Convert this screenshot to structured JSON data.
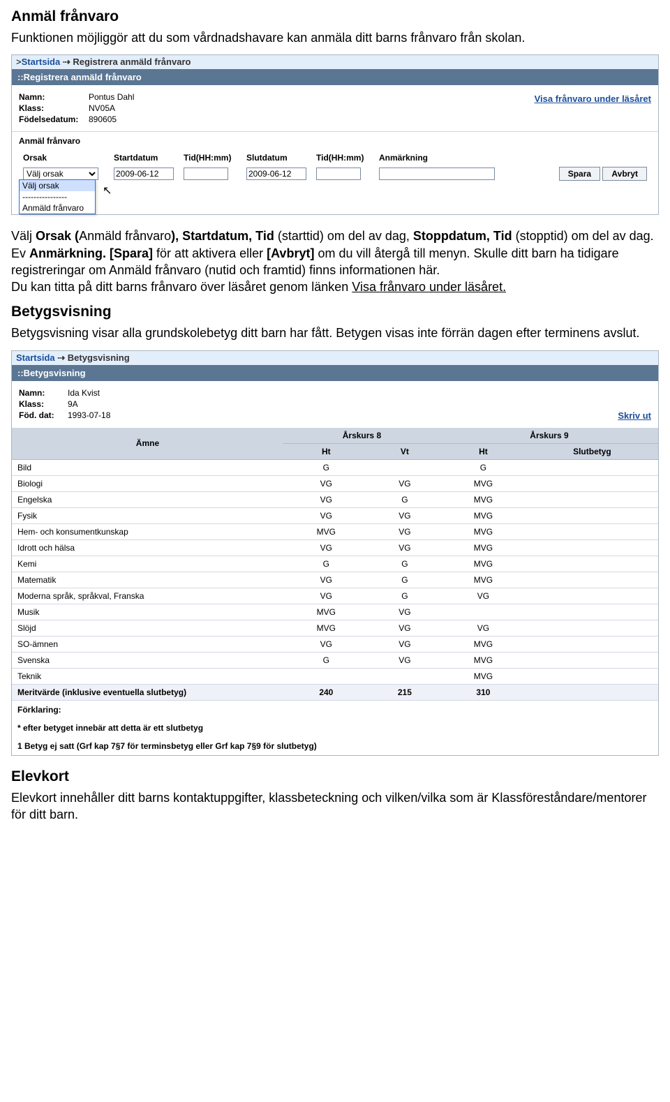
{
  "s1": {
    "title": "Anmäl frånvaro",
    "intro": "Funktionen möjliggör att du som vårdnadshavare kan anmäla ditt barns frånvaro från skolan."
  },
  "shot1": {
    "breadcrumb_root": "Startsida",
    "breadcrumb_root_prefix": ">",
    "breadcrumb_leaf": "Registrera anmäld frånvaro",
    "titlebar": "::Registrera anmäld frånvaro",
    "name_lbl": "Namn:",
    "name_val": "Pontus Dahl",
    "class_lbl": "Klass:",
    "class_val": "NV05A",
    "dob_lbl": "Födelsedatum:",
    "dob_val": "890605",
    "link_right": "Visa frånvaro under läsåret",
    "subheader": "Anmäl frånvaro",
    "cols": {
      "orsak": "Orsak",
      "startd": "Startdatum",
      "startt": "Tid(HH:mm)",
      "slutd": "Slutdatum",
      "slutt": "Tid(HH:mm)",
      "anm": "Anmärkning"
    },
    "inputs": {
      "orsak_selected": "Välj orsak",
      "startd": "2009-06-12",
      "slutd": "2009-06-12"
    },
    "dropdown": {
      "opt1": "Välj orsak",
      "opt2": "----------------",
      "opt3": "Anmäld frånvaro"
    },
    "btn_save": "Spara",
    "btn_cancel": "Avbryt"
  },
  "para2": {
    "t1": "Välj ",
    "b1": "Orsak (",
    "t2": "Anmäld frånvaro",
    "b2": "), Startdatum, Tid ",
    "t3": "(starttid) om del av dag, ",
    "b3": "Stoppdatum, Tid ",
    "t4": "(stopptid) om del av dag. Ev ",
    "b4": "Anmärkning. [Spara] ",
    "t5": "för att aktivera eller ",
    "b5": "[Avbryt] ",
    "t6": "om du vill återgå till menyn. Skulle ditt barn ha tidigare registreringar om Anmäld frånvaro (nutid och framtid) finns informationen här.",
    "line2a": "Du kan titta på ditt barns frånvaro över läsåret genom länken ",
    "link": "Visa frånvaro under läsåret."
  },
  "s2": {
    "title": "Betygsvisning",
    "intro": "Betygsvisning visar alla grundskolebetyg ditt barn har fått. Betygen visas inte förrän dagen efter terminens avslut."
  },
  "shot2": {
    "breadcrumb_root": "Startsida",
    "breadcrumb_leaf": "Betygsvisning",
    "titlebar": "::Betygsvisning",
    "name_lbl": "Namn:",
    "name_val": "Ida Kvist",
    "class_lbl": "Klass:",
    "class_val": "9A",
    "dob_lbl": "Föd. dat:",
    "dob_val": "1993-07-18",
    "print": "Skriv ut",
    "head_subject": "Ämne",
    "head_y8": "Årskurs 8",
    "head_y9": "Årskurs 9",
    "sub_ht": "Ht",
    "sub_vt": "Vt",
    "sub_ht2": "Ht",
    "sub_slut": "Slutbetyg",
    "rows": [
      {
        "s": "Bild",
        "a": "G",
        "b": "",
        "c": "G",
        "d": ""
      },
      {
        "s": "Biologi",
        "a": "VG",
        "b": "VG",
        "c": "MVG",
        "d": ""
      },
      {
        "s": "Engelska",
        "a": "VG",
        "b": "G",
        "c": "MVG",
        "d": ""
      },
      {
        "s": "Fysik",
        "a": "VG",
        "b": "VG",
        "c": "MVG",
        "d": ""
      },
      {
        "s": "Hem- och konsumentkunskap",
        "a": "MVG",
        "b": "VG",
        "c": "MVG",
        "d": ""
      },
      {
        "s": "Idrott och hälsa",
        "a": "VG",
        "b": "VG",
        "c": "MVG",
        "d": ""
      },
      {
        "s": "Kemi",
        "a": "G",
        "b": "G",
        "c": "MVG",
        "d": ""
      },
      {
        "s": "Matematik",
        "a": "VG",
        "b": "G",
        "c": "MVG",
        "d": ""
      },
      {
        "s": "Moderna språk, språkval, Franska",
        "a": "VG",
        "b": "G",
        "c": "VG",
        "d": ""
      },
      {
        "s": "Musik",
        "a": "MVG",
        "b": "VG",
        "c": "",
        "d": ""
      },
      {
        "s": "Slöjd",
        "a": "MVG",
        "b": "VG",
        "c": "VG",
        "d": ""
      },
      {
        "s": "SO-ämnen",
        "a": "VG",
        "b": "VG",
        "c": "MVG",
        "d": ""
      },
      {
        "s": "Svenska",
        "a": "G",
        "b": "VG",
        "c": "MVG",
        "d": ""
      },
      {
        "s": "Teknik",
        "a": "",
        "b": "",
        "c": "MVG",
        "d": ""
      }
    ],
    "merit_label": "Meritvärde (inklusive eventuella slutbetyg)",
    "merit_a": "240",
    "merit_b": "215",
    "merit_c": "310",
    "expl_label": "Förklaring:",
    "expl1": "* efter betyget innebär att detta är ett slutbetyg",
    "expl2": "1 Betyg ej satt (Grf kap 7§7 för terminsbetyg eller Grf kap 7§9 för slutbetyg)"
  },
  "s3": {
    "title": "Elevkort",
    "intro": "Elevkort innehåller ditt barns kontaktuppgifter, klassbeteckning och vilken/vilka som är Klassföreståndare/mentorer för ditt barn."
  }
}
